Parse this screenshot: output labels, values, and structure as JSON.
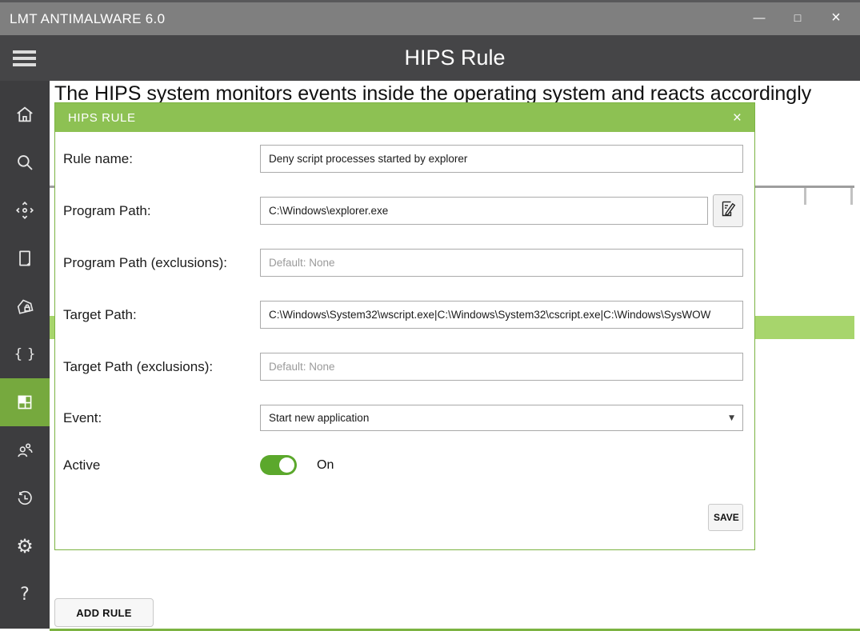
{
  "window": {
    "title": "LMT ANTIMALWARE 6.0",
    "controls": {
      "minimize": "—",
      "maximize": "□",
      "close": "×"
    }
  },
  "header": {
    "title": "HIPS Rule",
    "menu_icon": "hamburger-icon"
  },
  "sidebar": {
    "active_index": 6,
    "items": [
      {
        "icon": "home-icon"
      },
      {
        "icon": "search-icon"
      },
      {
        "icon": "scan-icon"
      },
      {
        "icon": "device-icon"
      },
      {
        "icon": "protected-home-icon"
      },
      {
        "icon": "braces-icon",
        "glyph": "{ }"
      },
      {
        "icon": "rules-grid-icon",
        "active": true
      },
      {
        "icon": "users-icon"
      },
      {
        "icon": "history-icon"
      },
      {
        "icon": "settings-gear-icon",
        "glyph": "⚙"
      },
      {
        "icon": "help-icon",
        "glyph": "?"
      }
    ]
  },
  "content": {
    "heading": "The HIPS system monitors events inside the operating system and reacts accordingly",
    "add_rule_label": "ADD RULE"
  },
  "dialog": {
    "title": "HIPS RULE",
    "close_glyph": "×",
    "fields": {
      "rule_name": {
        "label": "Rule name:",
        "value": "Deny script processes started by explorer"
      },
      "program_path": {
        "label": "Program Path:",
        "value": "C:\\Windows\\explorer.exe",
        "edit_icon": "edit-document-icon"
      },
      "program_path_exclusions": {
        "label": "Program Path (exclusions):",
        "placeholder": "Default: None"
      },
      "target_path": {
        "label": "Target Path:",
        "value": "C:\\Windows\\System32\\wscript.exe|C:\\Windows\\System32\\cscript.exe|C:\\Windows\\SysWOW"
      },
      "target_path_exclusions": {
        "label": "Target Path (exclusions):",
        "placeholder": "Default: None"
      },
      "event": {
        "label": "Event:",
        "value": "Start new application",
        "arrow": "▼"
      },
      "active": {
        "label": "Active",
        "state": "On"
      }
    },
    "save_label": "SAVE"
  },
  "colors": {
    "accent_green": "#8dc153",
    "sidebar_active_green": "#76a93e",
    "toggle_green": "#5ba82c",
    "highlight_row_green": "#a7d56c",
    "titlebar_gray": "#7f7f7f",
    "header_gray": "#454547",
    "sidebar_gray": "#3d3d3f"
  }
}
